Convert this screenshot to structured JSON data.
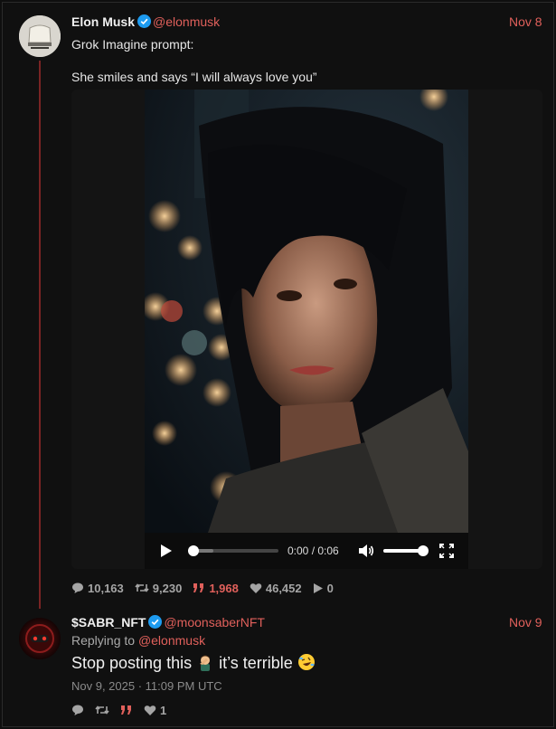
{
  "tweet": {
    "author_name": "Elon Musk",
    "author_handle": "@elonmusk",
    "date": "Nov 8",
    "line1": "Grok Imagine prompt:",
    "line2": "She smiles and says “I will always love you”",
    "video": {
      "time": "0:00 / 0:06",
      "progress": 0.0,
      "volume": 1.0
    },
    "stats": {
      "replies": "10,163",
      "retweets": "9,230",
      "quotes": "1,968",
      "likes": "46,452",
      "views": "0"
    }
  },
  "reply": {
    "author_name": "$SABR_NFT",
    "author_handle": "@moonsaberNFT",
    "date": "Nov 9",
    "replying_prefix": "Replying to",
    "replying_handle": "@elonmusk",
    "text_a": "Stop posting this",
    "text_b": "it’s terrible",
    "timestamp": "Nov 9, 2025 · 11:09 PM UTC",
    "stats": {
      "likes": "1"
    }
  },
  "colors": {
    "accent": "#e0605b",
    "verified": "#1d9bf0",
    "thread_line": "#7a2424",
    "background": "#101010"
  },
  "icons": [
    "verified-badge-icon",
    "play-icon",
    "volume-icon",
    "fullscreen-icon",
    "comment-icon",
    "retweet-icon",
    "quote-icon",
    "heart-icon",
    "views-play-icon",
    "facepalm-emoji-icon",
    "rofl-emoji-icon"
  ]
}
